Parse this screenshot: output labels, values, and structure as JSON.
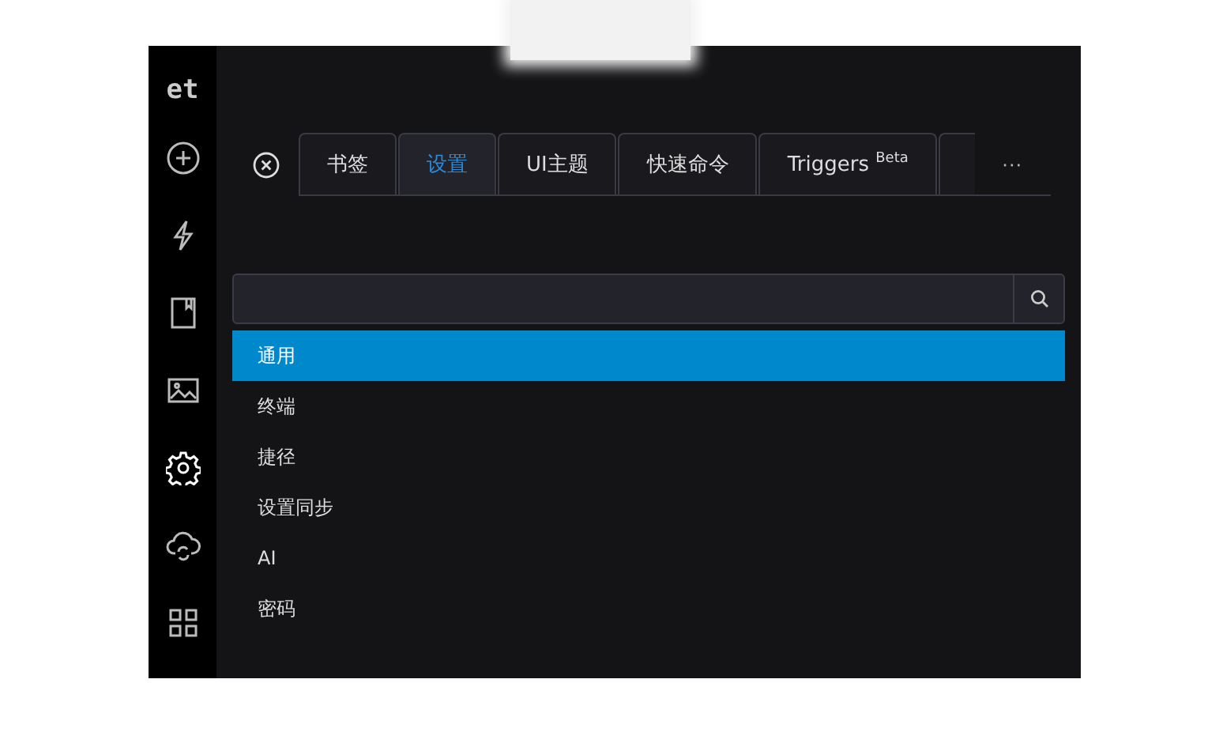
{
  "sidebar": {
    "logo": "et",
    "items": [
      {
        "kind": "add",
        "selected": false
      },
      {
        "kind": "bolt",
        "selected": false
      },
      {
        "kind": "bookmark",
        "selected": false
      },
      {
        "kind": "image",
        "selected": false
      },
      {
        "kind": "settings",
        "selected": true
      },
      {
        "kind": "cloud",
        "selected": false
      },
      {
        "kind": "grid",
        "selected": false
      }
    ]
  },
  "tabs": [
    {
      "label": "书签",
      "selected": false
    },
    {
      "label": "设置",
      "selected": true
    },
    {
      "label": "UI主题",
      "selected": false
    },
    {
      "label": "快速命令",
      "selected": false
    },
    {
      "label": "Triggers $^{Beta}$",
      "selected": false
    }
  ],
  "more": "···",
  "settings_list": [
    {
      "label": "通用",
      "selected": true
    },
    {
      "label": "终端",
      "selected": false
    },
    {
      "label": "捷径",
      "selected": false
    },
    {
      "label": "设置同步",
      "selected": false
    },
    {
      "label": "AI",
      "selected": false
    },
    {
      "label": "密码",
      "selected": false
    }
  ]
}
